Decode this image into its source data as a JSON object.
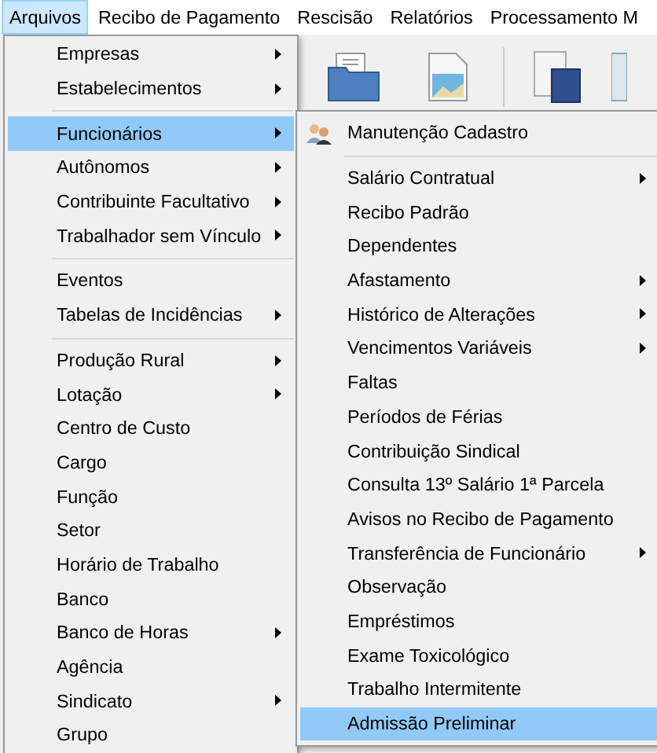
{
  "menubar": [
    {
      "label": "Arquivos",
      "selected": true
    },
    {
      "label": "Recibo de Pagamento",
      "selected": false
    },
    {
      "label": "Rescisão",
      "selected": false
    },
    {
      "label": "Relatórios",
      "selected": false
    },
    {
      "label": "Processamento M",
      "selected": false
    }
  ],
  "menu": {
    "items": [
      {
        "kind": "item",
        "label": "Empresas",
        "submenu": true,
        "selected": false
      },
      {
        "kind": "item",
        "label": "Estabelecimentos",
        "submenu": true,
        "selected": false
      },
      {
        "kind": "separator"
      },
      {
        "kind": "item",
        "label": "Funcionários",
        "submenu": true,
        "selected": true
      },
      {
        "kind": "item",
        "label": "Autônomos",
        "submenu": true,
        "selected": false
      },
      {
        "kind": "item",
        "label": "Contribuinte Facultativo",
        "submenu": true,
        "selected": false
      },
      {
        "kind": "item",
        "label": "Trabalhador sem Vínculo",
        "submenu": true,
        "selected": false
      },
      {
        "kind": "separator"
      },
      {
        "kind": "item",
        "label": "Eventos",
        "submenu": false,
        "selected": false
      },
      {
        "kind": "item",
        "label": "Tabelas de Incidências",
        "submenu": true,
        "selected": false
      },
      {
        "kind": "separator"
      },
      {
        "kind": "item",
        "label": "Produção Rural",
        "submenu": true,
        "selected": false
      },
      {
        "kind": "item",
        "label": "Lotação",
        "submenu": true,
        "selected": false
      },
      {
        "kind": "item",
        "label": "Centro de Custo",
        "submenu": false,
        "selected": false
      },
      {
        "kind": "item",
        "label": "Cargo",
        "submenu": false,
        "selected": false
      },
      {
        "kind": "item",
        "label": "Função",
        "submenu": false,
        "selected": false
      },
      {
        "kind": "item",
        "label": "Setor",
        "submenu": false,
        "selected": false
      },
      {
        "kind": "item",
        "label": "Horário de Trabalho",
        "submenu": false,
        "selected": false
      },
      {
        "kind": "item",
        "label": "Banco",
        "submenu": false,
        "selected": false
      },
      {
        "kind": "item",
        "label": "Banco de Horas",
        "submenu": true,
        "selected": false
      },
      {
        "kind": "item",
        "label": "Agência",
        "submenu": false,
        "selected": false
      },
      {
        "kind": "item",
        "label": "Sindicato",
        "submenu": true,
        "selected": false
      },
      {
        "kind": "item",
        "label": "Grupo",
        "submenu": false,
        "selected": false
      }
    ]
  },
  "submenu": {
    "items": [
      {
        "kind": "icon-item",
        "label": "Manutenção Cadastro",
        "submenu": false,
        "selected": false
      },
      {
        "kind": "separator"
      },
      {
        "kind": "item",
        "label": "Salário Contratual",
        "submenu": true,
        "selected": false
      },
      {
        "kind": "item",
        "label": "Recibo Padrão",
        "submenu": false,
        "selected": false
      },
      {
        "kind": "item",
        "label": "Dependentes",
        "submenu": false,
        "selected": false
      },
      {
        "kind": "item",
        "label": "Afastamento",
        "submenu": true,
        "selected": false
      },
      {
        "kind": "item",
        "label": "Histórico de Alterações",
        "submenu": true,
        "selected": false
      },
      {
        "kind": "item",
        "label": "Vencimentos Variáveis",
        "submenu": true,
        "selected": false
      },
      {
        "kind": "item",
        "label": "Faltas",
        "submenu": false,
        "selected": false
      },
      {
        "kind": "item",
        "label": "Períodos de Férias",
        "submenu": false,
        "selected": false
      },
      {
        "kind": "item",
        "label": "Contribuição Sindical",
        "submenu": false,
        "selected": false
      },
      {
        "kind": "item",
        "label": "Consulta 13º Salário 1ª Parcela",
        "submenu": false,
        "selected": false
      },
      {
        "kind": "item",
        "label": "Avisos no Recibo de Pagamento",
        "submenu": false,
        "selected": false
      },
      {
        "kind": "item",
        "label": "Transferência de Funcionário",
        "submenu": true,
        "selected": false
      },
      {
        "kind": "item",
        "label": "Observação",
        "submenu": false,
        "selected": false
      },
      {
        "kind": "item",
        "label": "Empréstimos",
        "submenu": false,
        "selected": false
      },
      {
        "kind": "item",
        "label": "Exame Toxicológico",
        "submenu": false,
        "selected": false
      },
      {
        "kind": "item",
        "label": "Trabalho Intermitente",
        "submenu": false,
        "selected": false
      },
      {
        "kind": "item",
        "label": "Admissão Preliminar",
        "submenu": false,
        "selected": true
      }
    ]
  }
}
